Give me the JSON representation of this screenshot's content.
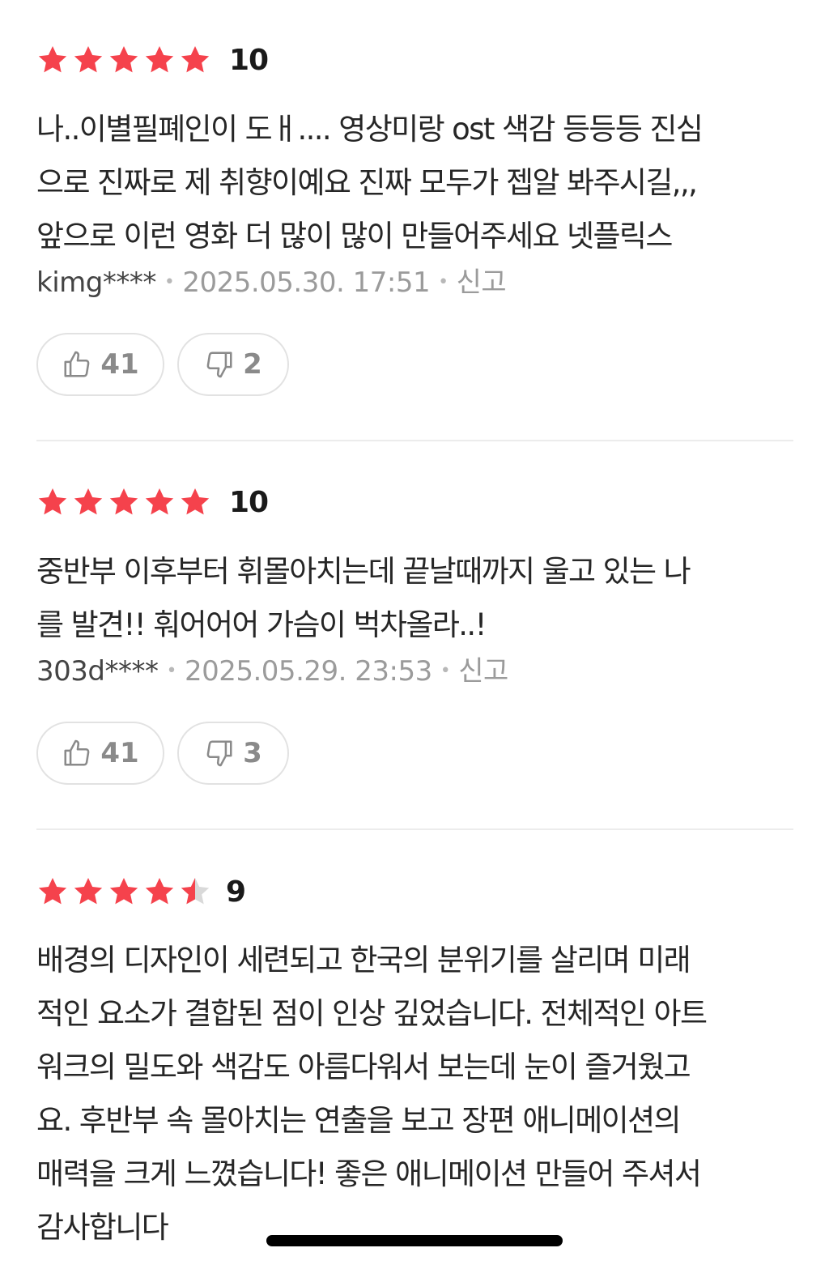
{
  "colors": {
    "star_filled": "#f5424c",
    "star_empty": "#d9d9d9",
    "text": "#262626",
    "meta": "#9b9b9b"
  },
  "reviews": [
    {
      "score": "10",
      "stars": 5,
      "text": "나..이별필폐인이 도ㅐ.... 영상미랑 ost 색감 등등등 진심\n으로 진짜로 제 취향이예요 진짜 모두가 젭알 봐주시길,,,\n앞으로 이런 영화 더 많이 많이 만들어주세요 넷플릭스",
      "author": "kimg****",
      "date": "2025.05.30. 17:51",
      "report": "신고",
      "likes": "41",
      "dislikes": "2"
    },
    {
      "score": "10",
      "stars": 5,
      "text": "중반부 이후부터 휘몰아치는데 끝날때까지 울고 있는 나\n를 발견!! 훠어어어 가슴이 벅차올라..!",
      "author": "303d****",
      "date": "2025.05.29. 23:53",
      "report": "신고",
      "likes": "41",
      "dislikes": "3"
    },
    {
      "score": "9",
      "stars": 4.5,
      "text": "배경의 디자인이 세련되고 한국의 분위기를 살리며 미래\n적인 요소가 결합된 점이 인상 깊었습니다. 전체적인 아트\n워크의 밀도와 색감도 아름다워서 보는데 눈이 즐거웠고\n요. 후반부 속 몰아치는 연출을 보고 장편 애니메이션의\n매력을 크게 느꼈습니다! 좋은 애니메이션 만들어 주셔서\n감사합니다"
    }
  ]
}
